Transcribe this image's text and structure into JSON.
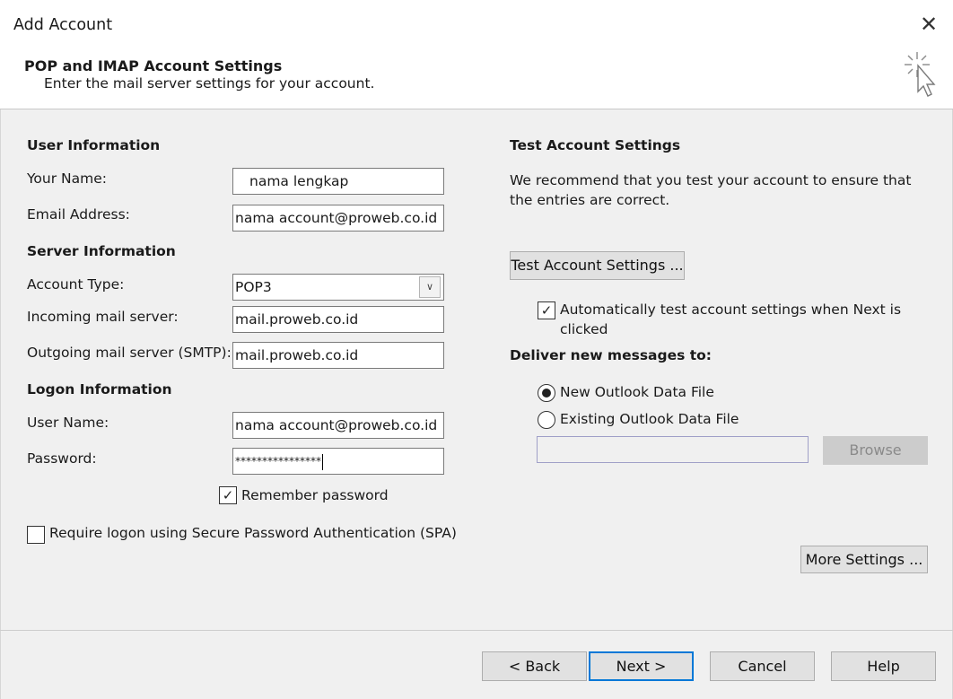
{
  "window": {
    "title": "Add Account",
    "close_glyph": "✕"
  },
  "header": {
    "heading": "POP and IMAP Account Settings",
    "subheading": "Enter the mail server settings for your account.",
    "icon": "sparkle-cursor-icon"
  },
  "user_info": {
    "section": "User Information",
    "your_name_label": "Your Name:",
    "your_name_value": "nama lengkap",
    "email_label": "Email Address:",
    "email_value": "nama account@proweb.co.id"
  },
  "server_info": {
    "section": "Server Information",
    "account_type_label": "Account Type:",
    "account_type_value": "POP3",
    "incoming_label": "Incoming mail server:",
    "incoming_value": "mail.proweb.co.id",
    "outgoing_label": "Outgoing mail server (SMTP):",
    "outgoing_value": "mail.proweb.co.id"
  },
  "logon_info": {
    "section": "Logon Information",
    "username_label": "User Name:",
    "username_value": "nama account@proweb.co.id",
    "password_label": "Password:",
    "password_value": "****************",
    "remember_label": "Remember password",
    "remember_checked": true,
    "spa_label": "Require logon using Secure Password Authentication (SPA)",
    "spa_checked": false
  },
  "test": {
    "section": "Test Account Settings",
    "description": "We recommend that you test your account to ensure that the entries are correct.",
    "button": "Test Account Settings ...",
    "auto_test_label": "Automatically test account settings when Next is clicked",
    "auto_test_checked": true
  },
  "deliver": {
    "section": "Deliver new messages to:",
    "option_new": "New Outlook Data File",
    "option_existing": "Existing Outlook Data File",
    "selected": "new",
    "path_value": "",
    "browse_button": "Browse"
  },
  "more_settings_button": "More Settings ...",
  "footer": {
    "back": "< Back",
    "next": "Next >",
    "cancel": "Cancel",
    "help": "Help"
  },
  "colors": {
    "dialog_bg": "#f0f0f0",
    "accent": "#0078d7",
    "button_bg": "#e1e1e1"
  }
}
